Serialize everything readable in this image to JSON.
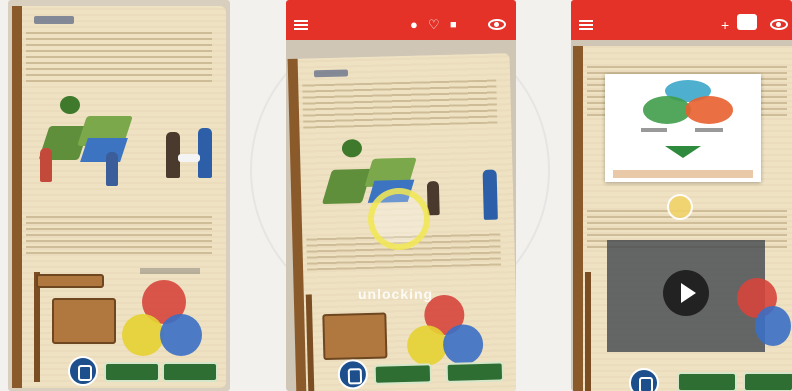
{
  "panel1": {
    "sign_label": "",
    "venn_labels": [],
    "buttons": []
  },
  "panel2": {
    "status_time": "",
    "overlay_text": "unlocking"
  },
  "panel3": {
    "status_time": "",
    "card_labels": []
  },
  "colors": {
    "appbar": "#e53229",
    "book_paper": "#efe2c3",
    "venn_red": "#d6453c",
    "venn_yellow": "#e6d232",
    "venn_blue": "#3b6fc4",
    "venn_green": "#3f9d4a"
  },
  "icons": {
    "menu": "hamburger-icon",
    "bulb": "lightbulb-icon",
    "heart": "heart-icon",
    "person": "person-icon",
    "eye": "eye-icon",
    "plus": "plus-icon",
    "camera": "camera-icon",
    "play": "play-icon"
  }
}
